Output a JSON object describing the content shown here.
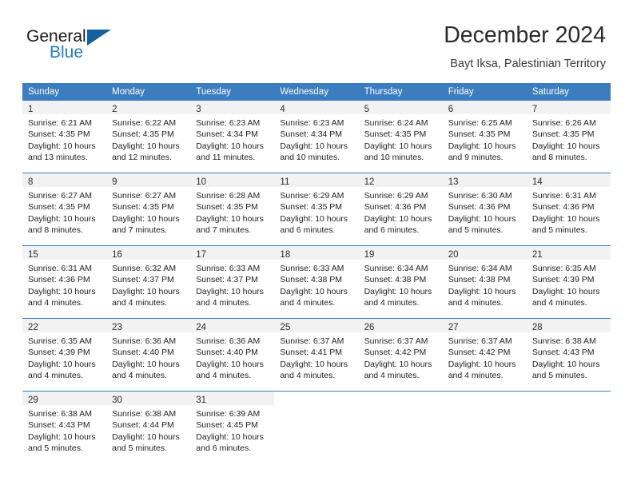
{
  "brand": {
    "name_part1": "General",
    "name_part2": "Blue",
    "logo_icon": "blue-triangle-mark",
    "accent_color": "#1f7ec4",
    "header_color": "#3b7dbf"
  },
  "header": {
    "title": "December 2024",
    "subtitle": "Bayt Iksa, Palestinian Territory"
  },
  "calendar": {
    "weekday_headers": [
      "Sunday",
      "Monday",
      "Tuesday",
      "Wednesday",
      "Thursday",
      "Friday",
      "Saturday"
    ],
    "weeks": [
      [
        {
          "day": "1",
          "sunrise": "Sunrise: 6:21 AM",
          "sunset": "Sunset: 4:35 PM",
          "daylight1": "Daylight: 10 hours",
          "daylight2": "and 13 minutes."
        },
        {
          "day": "2",
          "sunrise": "Sunrise: 6:22 AM",
          "sunset": "Sunset: 4:35 PM",
          "daylight1": "Daylight: 10 hours",
          "daylight2": "and 12 minutes."
        },
        {
          "day": "3",
          "sunrise": "Sunrise: 6:23 AM",
          "sunset": "Sunset: 4:34 PM",
          "daylight1": "Daylight: 10 hours",
          "daylight2": "and 11 minutes."
        },
        {
          "day": "4",
          "sunrise": "Sunrise: 6:23 AM",
          "sunset": "Sunset: 4:34 PM",
          "daylight1": "Daylight: 10 hours",
          "daylight2": "and 10 minutes."
        },
        {
          "day": "5",
          "sunrise": "Sunrise: 6:24 AM",
          "sunset": "Sunset: 4:35 PM",
          "daylight1": "Daylight: 10 hours",
          "daylight2": "and 10 minutes."
        },
        {
          "day": "6",
          "sunrise": "Sunrise: 6:25 AM",
          "sunset": "Sunset: 4:35 PM",
          "daylight1": "Daylight: 10 hours",
          "daylight2": "and 9 minutes."
        },
        {
          "day": "7",
          "sunrise": "Sunrise: 6:26 AM",
          "sunset": "Sunset: 4:35 PM",
          "daylight1": "Daylight: 10 hours",
          "daylight2": "and 8 minutes."
        }
      ],
      [
        {
          "day": "8",
          "sunrise": "Sunrise: 6:27 AM",
          "sunset": "Sunset: 4:35 PM",
          "daylight1": "Daylight: 10 hours",
          "daylight2": "and 8 minutes."
        },
        {
          "day": "9",
          "sunrise": "Sunrise: 6:27 AM",
          "sunset": "Sunset: 4:35 PM",
          "daylight1": "Daylight: 10 hours",
          "daylight2": "and 7 minutes."
        },
        {
          "day": "10",
          "sunrise": "Sunrise: 6:28 AM",
          "sunset": "Sunset: 4:35 PM",
          "daylight1": "Daylight: 10 hours",
          "daylight2": "and 7 minutes."
        },
        {
          "day": "11",
          "sunrise": "Sunrise: 6:29 AM",
          "sunset": "Sunset: 4:35 PM",
          "daylight1": "Daylight: 10 hours",
          "daylight2": "and 6 minutes."
        },
        {
          "day": "12",
          "sunrise": "Sunrise: 6:29 AM",
          "sunset": "Sunset: 4:36 PM",
          "daylight1": "Daylight: 10 hours",
          "daylight2": "and 6 minutes."
        },
        {
          "day": "13",
          "sunrise": "Sunrise: 6:30 AM",
          "sunset": "Sunset: 4:36 PM",
          "daylight1": "Daylight: 10 hours",
          "daylight2": "and 5 minutes."
        },
        {
          "day": "14",
          "sunrise": "Sunrise: 6:31 AM",
          "sunset": "Sunset: 4:36 PM",
          "daylight1": "Daylight: 10 hours",
          "daylight2": "and 5 minutes."
        }
      ],
      [
        {
          "day": "15",
          "sunrise": "Sunrise: 6:31 AM",
          "sunset": "Sunset: 4:36 PM",
          "daylight1": "Daylight: 10 hours",
          "daylight2": "and 4 minutes."
        },
        {
          "day": "16",
          "sunrise": "Sunrise: 6:32 AM",
          "sunset": "Sunset: 4:37 PM",
          "daylight1": "Daylight: 10 hours",
          "daylight2": "and 4 minutes."
        },
        {
          "day": "17",
          "sunrise": "Sunrise: 6:33 AM",
          "sunset": "Sunset: 4:37 PM",
          "daylight1": "Daylight: 10 hours",
          "daylight2": "and 4 minutes."
        },
        {
          "day": "18",
          "sunrise": "Sunrise: 6:33 AM",
          "sunset": "Sunset: 4:38 PM",
          "daylight1": "Daylight: 10 hours",
          "daylight2": "and 4 minutes."
        },
        {
          "day": "19",
          "sunrise": "Sunrise: 6:34 AM",
          "sunset": "Sunset: 4:38 PM",
          "daylight1": "Daylight: 10 hours",
          "daylight2": "and 4 minutes."
        },
        {
          "day": "20",
          "sunrise": "Sunrise: 6:34 AM",
          "sunset": "Sunset: 4:38 PM",
          "daylight1": "Daylight: 10 hours",
          "daylight2": "and 4 minutes."
        },
        {
          "day": "21",
          "sunrise": "Sunrise: 6:35 AM",
          "sunset": "Sunset: 4:39 PM",
          "daylight1": "Daylight: 10 hours",
          "daylight2": "and 4 minutes."
        }
      ],
      [
        {
          "day": "22",
          "sunrise": "Sunrise: 6:35 AM",
          "sunset": "Sunset: 4:39 PM",
          "daylight1": "Daylight: 10 hours",
          "daylight2": "and 4 minutes."
        },
        {
          "day": "23",
          "sunrise": "Sunrise: 6:36 AM",
          "sunset": "Sunset: 4:40 PM",
          "daylight1": "Daylight: 10 hours",
          "daylight2": "and 4 minutes."
        },
        {
          "day": "24",
          "sunrise": "Sunrise: 6:36 AM",
          "sunset": "Sunset: 4:40 PM",
          "daylight1": "Daylight: 10 hours",
          "daylight2": "and 4 minutes."
        },
        {
          "day": "25",
          "sunrise": "Sunrise: 6:37 AM",
          "sunset": "Sunset: 4:41 PM",
          "daylight1": "Daylight: 10 hours",
          "daylight2": "and 4 minutes."
        },
        {
          "day": "26",
          "sunrise": "Sunrise: 6:37 AM",
          "sunset": "Sunset: 4:42 PM",
          "daylight1": "Daylight: 10 hours",
          "daylight2": "and 4 minutes."
        },
        {
          "day": "27",
          "sunrise": "Sunrise: 6:37 AM",
          "sunset": "Sunset: 4:42 PM",
          "daylight1": "Daylight: 10 hours",
          "daylight2": "and 4 minutes."
        },
        {
          "day": "28",
          "sunrise": "Sunrise: 6:38 AM",
          "sunset": "Sunset: 4:43 PM",
          "daylight1": "Daylight: 10 hours",
          "daylight2": "and 5 minutes."
        }
      ],
      [
        {
          "day": "29",
          "sunrise": "Sunrise: 6:38 AM",
          "sunset": "Sunset: 4:43 PM",
          "daylight1": "Daylight: 10 hours",
          "daylight2": "and 5 minutes."
        },
        {
          "day": "30",
          "sunrise": "Sunrise: 6:38 AM",
          "sunset": "Sunset: 4:44 PM",
          "daylight1": "Daylight: 10 hours",
          "daylight2": "and 5 minutes."
        },
        {
          "day": "31",
          "sunrise": "Sunrise: 6:39 AM",
          "sunset": "Sunset: 4:45 PM",
          "daylight1": "Daylight: 10 hours",
          "daylight2": "and 6 minutes."
        },
        {
          "day": "",
          "sunrise": "",
          "sunset": "",
          "daylight1": "",
          "daylight2": ""
        },
        {
          "day": "",
          "sunrise": "",
          "sunset": "",
          "daylight1": "",
          "daylight2": ""
        },
        {
          "day": "",
          "sunrise": "",
          "sunset": "",
          "daylight1": "",
          "daylight2": ""
        },
        {
          "day": "",
          "sunrise": "",
          "sunset": "",
          "daylight1": "",
          "daylight2": ""
        }
      ]
    ]
  }
}
